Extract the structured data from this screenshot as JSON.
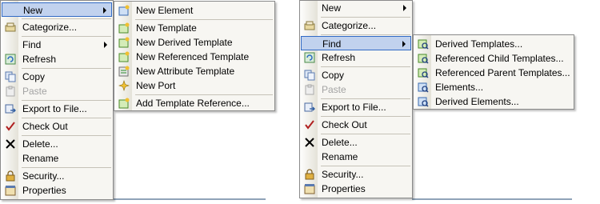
{
  "colors": {
    "menu_bg": "#f7f6f2",
    "highlight_bg": "#c1d2ee",
    "highlight_border": "#316ac5",
    "disabled_text": "#a3a3a3"
  },
  "left_context_menu": {
    "new": "New",
    "categorize": "Categorize...",
    "find": "Find",
    "refresh": "Refresh",
    "copy": "Copy",
    "paste": "Paste",
    "export": "Export to File...",
    "checkout": "Check Out",
    "delete": "Delete...",
    "rename": "Rename",
    "security": "Security...",
    "properties": "Properties"
  },
  "new_submenu": {
    "new_element": "New Element",
    "new_template": "New Template",
    "new_derived_template": "New Derived Template",
    "new_referenced_template": "New Referenced Template",
    "new_attribute_template": "New Attribute Template",
    "new_port": "New Port",
    "add_template_reference": "Add Template Reference..."
  },
  "right_context_menu": {
    "new": "New",
    "categorize": "Categorize...",
    "find": "Find",
    "refresh": "Refresh",
    "copy": "Copy",
    "paste": "Paste",
    "export": "Export to File...",
    "checkout": "Check Out",
    "delete": "Delete...",
    "rename": "Rename",
    "security": "Security...",
    "properties": "Properties"
  },
  "find_submenu": {
    "derived_templates": "Derived Templates...",
    "referenced_child_templates": "Referenced Child Templates...",
    "referenced_parent_templates": "Referenced Parent Templates...",
    "elements": "Elements...",
    "derived_elements": "Derived Elements..."
  }
}
